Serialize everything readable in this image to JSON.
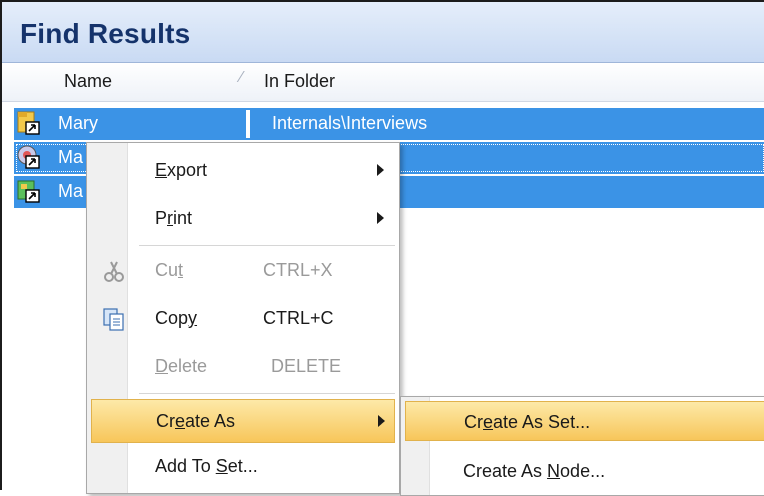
{
  "window": {
    "title": "Find Results"
  },
  "columns": {
    "name": "Name",
    "sort_glyph": "⁄",
    "folder": "In Folder"
  },
  "rows": [
    {
      "name": "Mary",
      "folder": "Internals\\Interviews",
      "icon": "shortcut-folder-icon"
    },
    {
      "name": "Ma",
      "folder": "",
      "icon": "shortcut-case-icon"
    },
    {
      "name": "Ma",
      "folder": "",
      "icon": "shortcut-node-icon"
    }
  ],
  "context_menu": {
    "items": [
      {
        "pre": "",
        "key": "E",
        "post": "xport",
        "shortcut": "",
        "submenu": true,
        "enabled": true
      },
      {
        "pre": "P",
        "key": "r",
        "post": "int",
        "shortcut": "",
        "submenu": true,
        "enabled": true
      },
      {
        "pre": "Cu",
        "key": "t",
        "post": "",
        "shortcut": "CTRL+X",
        "submenu": false,
        "enabled": false,
        "icon": "scissors-icon"
      },
      {
        "pre": "Cop",
        "key": "y",
        "post": "",
        "shortcut": "CTRL+C",
        "submenu": false,
        "enabled": true,
        "icon": "copy-icon"
      },
      {
        "pre": "",
        "key": "D",
        "post": "elete",
        "shortcut": "DELETE",
        "submenu": false,
        "enabled": false
      },
      {
        "pre": "Cr",
        "key": "e",
        "post": "ate As",
        "shortcut": "",
        "submenu": true,
        "enabled": true,
        "highlighted": true
      },
      {
        "pre": "Add To ",
        "key": "S",
        "post": "et...",
        "shortcut": "",
        "submenu": false,
        "enabled": true
      }
    ]
  },
  "submenu": {
    "items": [
      {
        "pre": "Cr",
        "key": "e",
        "post": "ate As Set...",
        "highlighted": true
      },
      {
        "pre": "Create As ",
        "key": "N",
        "post": "ode..."
      }
    ]
  },
  "colors": {
    "selection": "#3b93e6",
    "highlight": "#f7c65a",
    "title": "#15336b"
  }
}
